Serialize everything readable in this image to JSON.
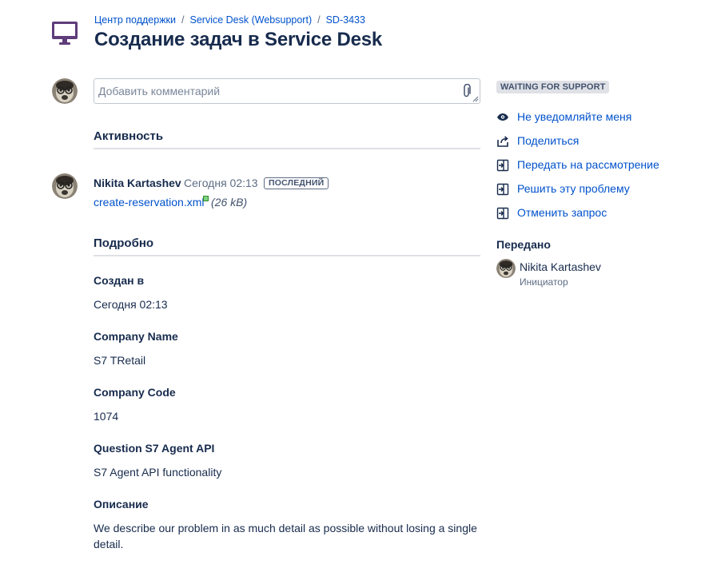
{
  "header": {
    "breadcrumb": {
      "help_center": "Центр поддержки",
      "service_desk": "Service Desk (Websupport)",
      "issue_key": "SD-3433",
      "separator": "/"
    },
    "title": "Создание задач в Service Desk",
    "portal_icon": "monitor-icon"
  },
  "comment": {
    "placeholder": "Добавить комментарий",
    "attach_icon": "paperclip-icon"
  },
  "activity": {
    "heading": "Активность",
    "items": [
      {
        "author": "Nikita Kartashev",
        "time": "Сегодня 02:13",
        "badge": "ПОСЛЕДНИЙ",
        "attachment_name": "create-reservation.xml",
        "attachment_size": "(26 kB)"
      }
    ]
  },
  "details": {
    "heading": "Подробно",
    "fields": [
      {
        "label": "Создан в",
        "value": "Сегодня 02:13"
      },
      {
        "label": "Company Name",
        "value": "S7 TRetail"
      },
      {
        "label": "Company Code",
        "value": "1074"
      },
      {
        "label": "Question S7 Agent API",
        "value": "S7 Agent API functionality"
      },
      {
        "label": "Описание",
        "value": "We describe our problem in as much detail as possible without losing a single detail."
      }
    ]
  },
  "sidebar": {
    "status": "WAITING FOR SUPPORT",
    "actions": [
      {
        "label": "Не уведомляйте меня",
        "icon": "eye-icon"
      },
      {
        "label": "Поделиться",
        "icon": "share-icon"
      },
      {
        "label": "Передать на рассмотрение",
        "icon": "transition-icon"
      },
      {
        "label": "Решить эту проблему",
        "icon": "transition-icon"
      },
      {
        "label": "Отменить запрос",
        "icon": "transition-icon"
      }
    ],
    "assigned_heading": "Передано",
    "assignee": {
      "name": "Nikita Kartashev",
      "role": "Инициатор"
    }
  },
  "colors": {
    "link": "#0052cc",
    "text": "#172b4d",
    "muted": "#5e6c84",
    "status_bg": "#dfe1e6",
    "portal_icon": "#5e3d7a"
  }
}
